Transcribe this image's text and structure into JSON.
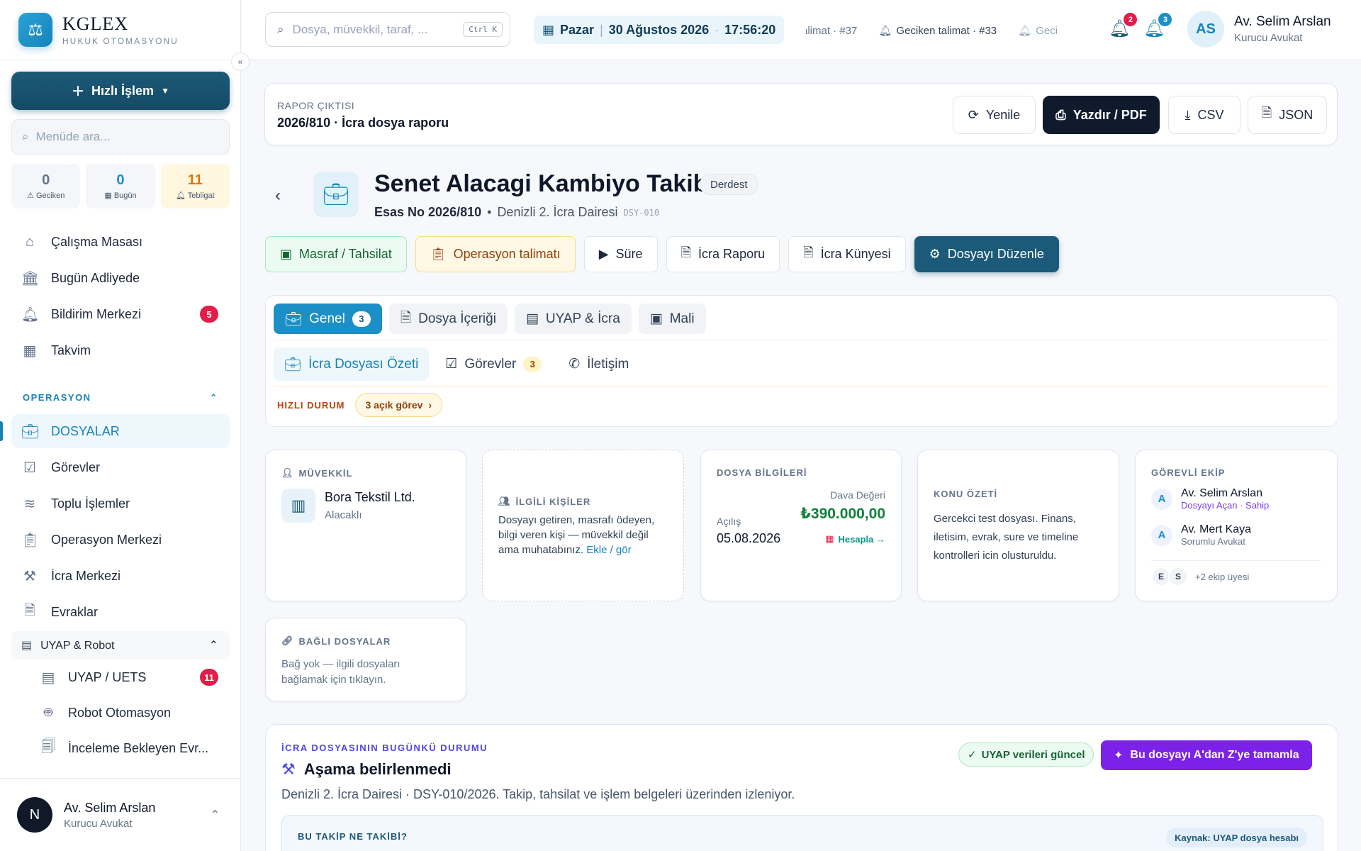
{
  "brand": {
    "name": "KGLEX",
    "subtitle": "HUKUK OTOMASYONU"
  },
  "sidebar": {
    "quick_action": "Hızlı İşlem",
    "search_placeholder": "Menüde ara...",
    "counters": [
      {
        "value": "0",
        "label": "Geciken"
      },
      {
        "value": "0",
        "label": "Bugün"
      },
      {
        "value": "11",
        "label": "Tebligat"
      }
    ],
    "items_top": [
      {
        "label": "Çalışma Masası",
        "icon": "home-icon"
      },
      {
        "label": "Bugün Adliyede",
        "icon": "courthouse-icon"
      },
      {
        "label": "Bildirim Merkezi",
        "icon": "bell-icon",
        "badge": "5"
      },
      {
        "label": "Takvim",
        "icon": "calendar-icon"
      }
    ],
    "section_operasyon": "OPERASYON",
    "items_ops": [
      {
        "label": "DOSYALAR",
        "icon": "briefcase-icon"
      },
      {
        "label": "Görevler",
        "icon": "checkbox-icon"
      },
      {
        "label": "Toplu İşlemler",
        "icon": "layers-icon"
      },
      {
        "label": "Operasyon Merkezi",
        "icon": "clipboard-icon"
      },
      {
        "label": "İcra Merkezi",
        "icon": "gavel-icon"
      },
      {
        "label": "Evraklar",
        "icon": "document-icon"
      }
    ],
    "group_uyap": "UYAP & Robot",
    "items_uyap": [
      {
        "label": "UYAP / UETS",
        "icon": "server-icon",
        "badge": "11"
      },
      {
        "label": "Robot Otomasyon",
        "icon": "robot-icon"
      },
      {
        "label": "İnceleme Bekleyen Evr...",
        "icon": "file-search-icon"
      }
    ],
    "user": {
      "initial": "N",
      "name": "Av. Selim Arslan",
      "role": "Kurucu Avukat"
    }
  },
  "topbar": {
    "search_placeholder": "Dosya, müvekkil, taraf, ...",
    "shortcut": "Ctrl K",
    "day": "Pazar",
    "date": "30 Ağustos 2026",
    "time": "17:56:20",
    "ticker": [
      "alimat · #37",
      "Geciken talimat · #33",
      "Geci"
    ],
    "bell_badges": [
      "2",
      "3"
    ],
    "user": {
      "initials": "AS",
      "name": "Av. Selim Arslan",
      "role": "Kurucu Avukat"
    }
  },
  "report": {
    "label": "RAPOR ÇIKTISI",
    "title": "2026/810 · İcra dosya raporu",
    "buttons": {
      "refresh": "Yenile",
      "print": "Yazdır / PDF",
      "csv": "CSV",
      "json": "JSON"
    }
  },
  "file": {
    "title": "Senet Alacagi Kambiyo Takibi",
    "status": "Derdest",
    "esas": "Esas No 2026/810",
    "court": "Denizli 2. İcra Dairesi",
    "code": "DSY-010"
  },
  "actions": {
    "expense": "Masraf / Tahsilat",
    "operation": "Operasyon talimatı",
    "duration": "Süre",
    "report": "İcra Raporu",
    "kunye": "İcra Künyesi",
    "edit": "Dosyayı Düzenle"
  },
  "tabs": [
    {
      "label": "Genel",
      "count": "3"
    },
    {
      "label": "Dosya İçeriği"
    },
    {
      "label": "UYAP & İcra"
    },
    {
      "label": "Mali"
    }
  ],
  "subtabs": [
    {
      "label": "İcra Dosyası Özeti"
    },
    {
      "label": "Görevler",
      "count": "3"
    },
    {
      "label": "İletişim"
    }
  ],
  "quick_status": {
    "label": "HIZLI DURUM",
    "pill": "3 açık görev"
  },
  "cards": {
    "client": {
      "title": "MÜVEKKİL",
      "name": "Bora Tekstil Ltd.",
      "role": "Alacaklı"
    },
    "related": {
      "title": "İLGİLİ KİŞİLER",
      "desc": "Dosyayı getiren, masrafı ödeyen, bilgi veren kişi — müvekkil değil ama muhatabınız.",
      "link": "Ekle / gör"
    },
    "info": {
      "title": "DOSYA BİLGİLERİ",
      "value_label": "Dava Değeri",
      "value": "₺390.000,00",
      "open_label": "Açılış",
      "open_date": "05.08.2026",
      "calc": "Hesapla →"
    },
    "summary": {
      "title": "KONU ÖZETİ",
      "text": "Gercekci test dosyası. Finans, iletisim, evrak, sure ve timeline kontrolleri icin olusturuldu."
    },
    "team": {
      "title": "GÖREVLİ EKİP",
      "members": [
        {
          "initial": "A",
          "name": "Av. Selim Arslan",
          "role": "Dosyayı Açan · Sahip"
        },
        {
          "initial": "A",
          "name": "Av. Mert Kaya",
          "role": "Sorumlu Avukat"
        }
      ],
      "extra_initials": [
        "E",
        "S"
      ],
      "extra": "+2 ekip üyesi"
    },
    "linked": {
      "title": "BAĞLI DOSYALAR",
      "text": "Bağ yok — ilgili dosyaları bağlamak için tıklayın."
    }
  },
  "status_panel": {
    "label": "İCRA DOSYASININ BUGÜNKÜ DURUMU",
    "title": "Aşama belirlenmedi",
    "desc": "Denizli 2. İcra Dairesi · DSY-010/2026. Takip, tahsilat ve işlem belgeleri üzerinden izleniyor.",
    "ok": "UYAP verileri güncel",
    "ai": "Bu dosyayı A'dan Z'ye tamamla",
    "inner_label": "BU TAKİP NE TAKİBİ?",
    "source": "Kaynak: UYAP dosya hesabı"
  }
}
